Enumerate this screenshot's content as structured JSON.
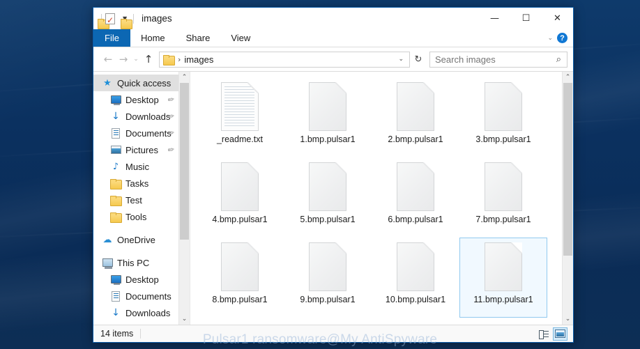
{
  "desktop": {
    "watermark": "Pulsar1 ransomware@My AntiSpyware"
  },
  "window": {
    "title": "images",
    "quick_access_toolbar": [
      {
        "name": "folder-icon",
        "label": ""
      },
      {
        "name": "properties-icon",
        "label": ""
      },
      {
        "name": "new-folder-icon",
        "label": ""
      },
      {
        "name": "customize-caret-icon",
        "label": "▼"
      }
    ],
    "controls": {
      "minimize": "—",
      "maximize": "☐",
      "close": "✕"
    },
    "ribbon": {
      "tabs": [
        {
          "label": "File",
          "active": true
        },
        {
          "label": "Home",
          "active": false
        },
        {
          "label": "Share",
          "active": false
        },
        {
          "label": "View",
          "active": false
        }
      ],
      "collapse_caret": "⌄",
      "help_label": "?"
    },
    "address_bar": {
      "back": "←",
      "forward": "→",
      "history_caret": "⌄",
      "up": "↑",
      "separator": "›",
      "path": "images",
      "dropdown_caret": "⌄",
      "refresh": "↻"
    },
    "search": {
      "placeholder": "Search images",
      "value": "",
      "icon": "⌕"
    }
  },
  "sidebar": {
    "scroll": {
      "up_arrow": "⌃",
      "down_arrow": "⌄"
    },
    "items": [
      {
        "label": "Quick access",
        "icon": "star-icon",
        "level": 0,
        "selected": true,
        "pinned": false
      },
      {
        "label": "Desktop",
        "icon": "monitor-icon",
        "level": 1,
        "selected": false,
        "pinned": true
      },
      {
        "label": "Downloads",
        "icon": "download-icon",
        "level": 1,
        "selected": false,
        "pinned": true
      },
      {
        "label": "Documents",
        "icon": "document-icon",
        "level": 1,
        "selected": false,
        "pinned": true
      },
      {
        "label": "Pictures",
        "icon": "picture-icon",
        "level": 1,
        "selected": false,
        "pinned": true
      },
      {
        "label": "Music",
        "icon": "music-icon",
        "level": 1,
        "selected": false,
        "pinned": false
      },
      {
        "label": "Tasks",
        "icon": "folder-icon",
        "level": 1,
        "selected": false,
        "pinned": false
      },
      {
        "label": "Test",
        "icon": "folder-icon",
        "level": 1,
        "selected": false,
        "pinned": false
      },
      {
        "label": "Tools",
        "icon": "folder-icon",
        "level": 1,
        "selected": false,
        "pinned": false
      },
      {
        "label": "__GAP__",
        "icon": "",
        "level": 0,
        "selected": false,
        "pinned": false
      },
      {
        "label": "OneDrive",
        "icon": "cloud-icon",
        "level": 0,
        "selected": false,
        "pinned": false
      },
      {
        "label": "__GAP__",
        "icon": "",
        "level": 0,
        "selected": false,
        "pinned": false
      },
      {
        "label": "This PC",
        "icon": "pc-icon",
        "level": 0,
        "selected": false,
        "pinned": false
      },
      {
        "label": "Desktop",
        "icon": "monitor-icon",
        "level": 1,
        "selected": false,
        "pinned": false
      },
      {
        "label": "Documents",
        "icon": "document-icon",
        "level": 1,
        "selected": false,
        "pinned": false
      },
      {
        "label": "Downloads",
        "icon": "download-icon",
        "level": 1,
        "selected": false,
        "pinned": false
      }
    ]
  },
  "files": {
    "scroll": {
      "up_arrow": "⌃",
      "down_arrow": "⌄"
    },
    "items": [
      {
        "name": "_readme.txt",
        "kind": "text",
        "selected": false
      },
      {
        "name": "1.bmp.pulsar1",
        "kind": "blank",
        "selected": false
      },
      {
        "name": "2.bmp.pulsar1",
        "kind": "blank",
        "selected": false
      },
      {
        "name": "3.bmp.pulsar1",
        "kind": "blank",
        "selected": false
      },
      {
        "name": "4.bmp.pulsar1",
        "kind": "blank",
        "selected": false
      },
      {
        "name": "5.bmp.pulsar1",
        "kind": "blank",
        "selected": false
      },
      {
        "name": "6.bmp.pulsar1",
        "kind": "blank",
        "selected": false
      },
      {
        "name": "7.bmp.pulsar1",
        "kind": "blank",
        "selected": false
      },
      {
        "name": "8.bmp.pulsar1",
        "kind": "blank",
        "selected": false
      },
      {
        "name": "9.bmp.pulsar1",
        "kind": "blank",
        "selected": false
      },
      {
        "name": "10.bmp.pulsar1",
        "kind": "blank",
        "selected": false
      },
      {
        "name": "11.bmp.pulsar1",
        "kind": "blank",
        "selected": true
      }
    ]
  },
  "statusbar": {
    "item_count": "14 items",
    "views": [
      {
        "name": "details-view-button",
        "active": false
      },
      {
        "name": "large-icons-view-button",
        "active": true
      }
    ]
  },
  "colors": {
    "accent": "#0c67b3",
    "window_border": "#0a5ca8",
    "selection_border": "#91c9ef",
    "desktop": "#0b3160"
  }
}
